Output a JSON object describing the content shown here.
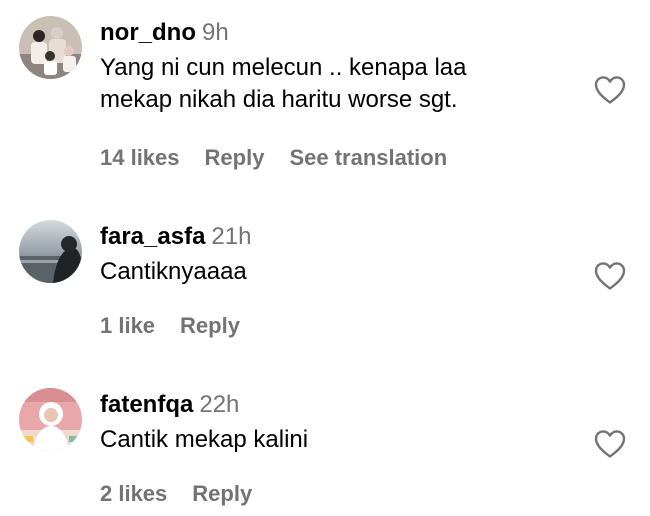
{
  "comments": [
    {
      "username": "nor_dno",
      "time": "9h",
      "text": "Yang ni cun melecun .. kenapa laa\nmekap nikah dia haritu worse sgt.",
      "likes": "14 likes",
      "reply": "Reply",
      "translate": "See translation",
      "heart_icon": "heart-outline-icon"
    },
    {
      "username": "fara_asfa",
      "time": "21h",
      "text": "Cantiknyaaaa",
      "likes": "1 like",
      "reply": "Reply",
      "heart_icon": "heart-outline-icon"
    },
    {
      "username": "fatenfqa",
      "time": "22h",
      "text": "Cantik mekap kalini",
      "likes": "2 likes",
      "reply": "Reply",
      "heart_icon": "heart-outline-icon"
    }
  ],
  "colors": {
    "text": "#000000",
    "secondary": "#737373",
    "background": "#ffffff",
    "heart_stroke": "#737373"
  }
}
